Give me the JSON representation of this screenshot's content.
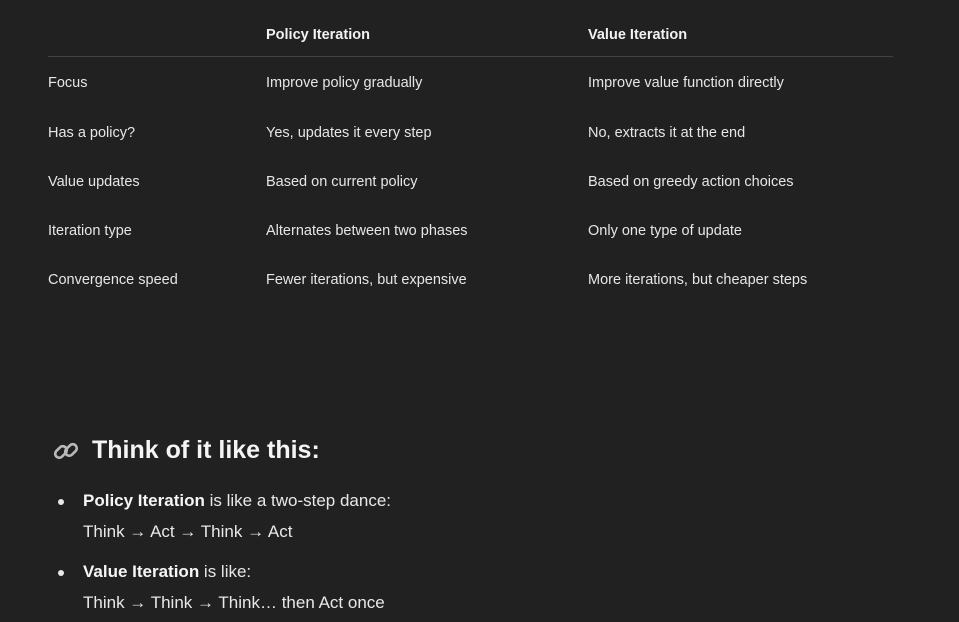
{
  "table": {
    "headers": [
      "",
      "Policy Iteration",
      "Value Iteration"
    ],
    "rows": [
      [
        "Focus",
        "Improve policy gradually",
        "Improve value function directly"
      ],
      [
        "Has a policy?",
        "Yes, updates it every step",
        "No, extracts it at the end"
      ],
      [
        "Value updates",
        "Based on current policy",
        "Based on greedy action choices"
      ],
      [
        "Iteration type",
        "Alternates between two phases",
        "Only one type of update"
      ],
      [
        "Convergence speed",
        "Fewer iterations, but expensive",
        "More iterations, but cheaper steps"
      ]
    ]
  },
  "section": {
    "icon": "link-icon",
    "title": "Think of it like this:"
  },
  "bullets": [
    {
      "bold": "Policy Iteration",
      "rest": " is like a two-step dance:",
      "line2": "Think → Act → Think → Act"
    },
    {
      "bold": "Value Iteration",
      "rest": " is like:",
      "line2": "Think → Think → Think… then Act once"
    }
  ]
}
